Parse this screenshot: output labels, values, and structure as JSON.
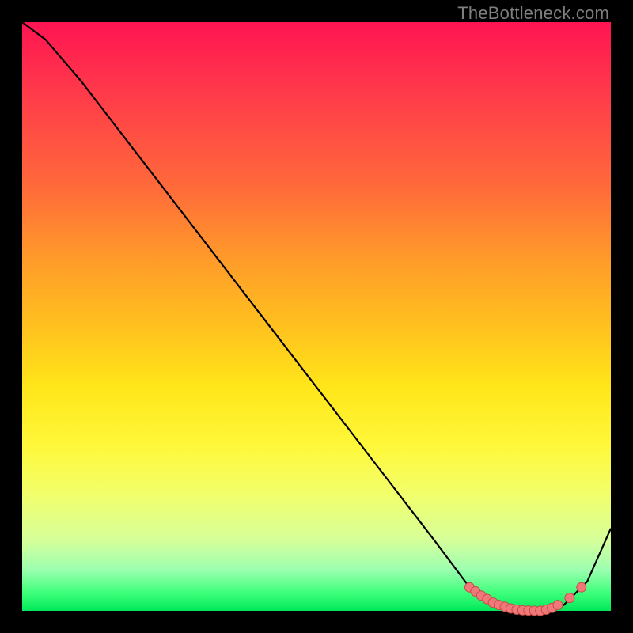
{
  "watermark": "TheBottleneck.com",
  "colors": {
    "background": "#000000",
    "curve_stroke": "#000000",
    "marker_fill": "#f07878",
    "marker_stroke": "#c74a4a",
    "gradient_top": "#ff1452",
    "gradient_bottom": "#00e85a"
  },
  "chart_data": {
    "type": "line",
    "title": "",
    "xlabel": "",
    "ylabel": "",
    "xlim": [
      0,
      100
    ],
    "ylim": [
      0,
      100
    ],
    "grid": false,
    "legend_position": "none",
    "series": [
      {
        "name": "bottleneck-curve",
        "x": [
          0,
          4,
          10,
          20,
          30,
          40,
          50,
          60,
          70,
          76,
          80,
          84,
          88,
          92,
          96,
          100
        ],
        "y": [
          100,
          97,
          90,
          77,
          64,
          51,
          38,
          25,
          12,
          4,
          1,
          0,
          0,
          1,
          5,
          14
        ]
      }
    ],
    "markers": {
      "name": "highlight-points",
      "x": [
        76,
        77,
        78,
        79,
        80,
        81,
        82,
        83,
        84,
        85,
        86,
        87,
        88,
        89,
        90,
        91,
        93,
        95
      ],
      "y": [
        4,
        3.3,
        2.6,
        2.0,
        1.4,
        1.0,
        0.7,
        0.4,
        0.2,
        0.1,
        0.05,
        0.02,
        0,
        0.2,
        0.5,
        1.0,
        2.2,
        4.0
      ]
    }
  }
}
